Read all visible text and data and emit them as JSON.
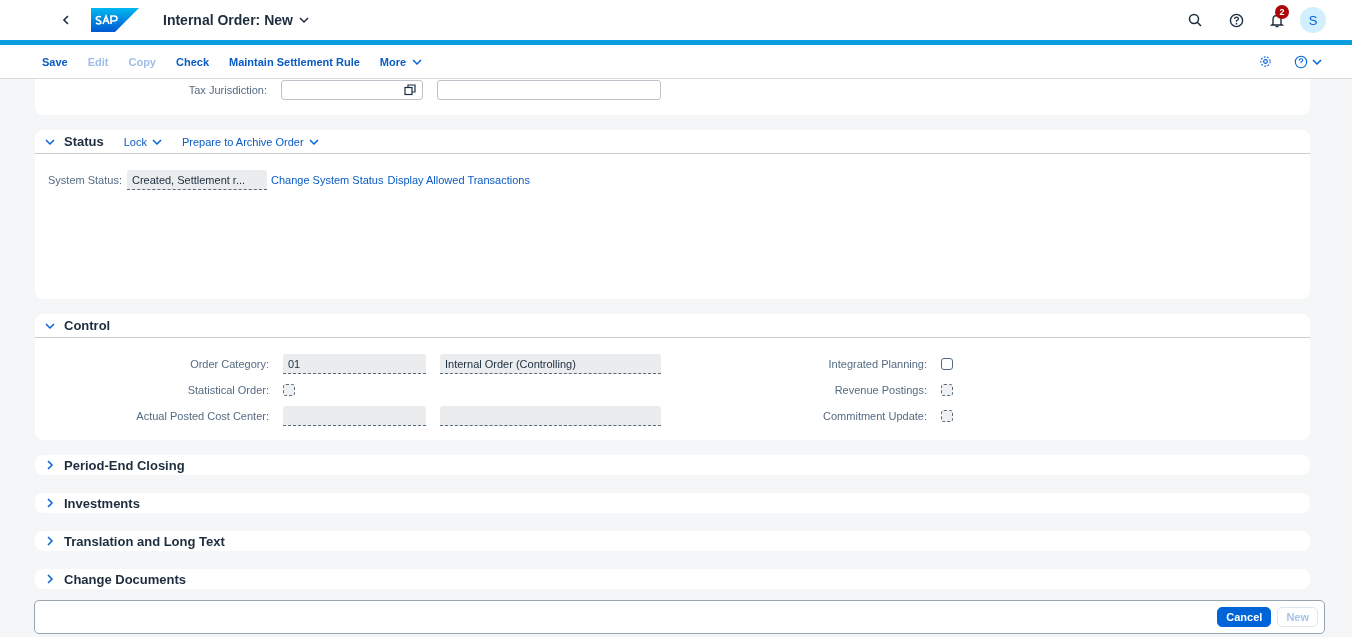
{
  "shell": {
    "title": "Internal Order: New",
    "notification_count": "2",
    "avatar": "S"
  },
  "toolbar": [
    {
      "label": "Save",
      "disabled": false,
      "kind": "button"
    },
    {
      "label": "Edit",
      "disabled": true,
      "kind": "button"
    },
    {
      "label": "Copy",
      "disabled": true,
      "kind": "button"
    },
    {
      "label": "Check",
      "disabled": false,
      "kind": "button"
    },
    {
      "label": "Maintain Settlement Rule",
      "disabled": false,
      "kind": "button"
    },
    {
      "label": "More",
      "disabled": false,
      "kind": "menu"
    }
  ],
  "tax_jurisdiction": {
    "label": "Tax Jurisdiction:"
  },
  "status_section": {
    "title": "Status",
    "expanded": true,
    "menus": [
      "Lock",
      "Prepare to Archive Order"
    ],
    "system_status_label": "System Status:",
    "system_status_value": "Created, Settlement r...",
    "links": [
      "Change System Status",
      "Display Allowed Transactions"
    ]
  },
  "control_section": {
    "title": "Control",
    "expanded": true,
    "left_rows": [
      {
        "label": "Order Category:",
        "kind": "fields",
        "values": [
          "01",
          "Internal Order (Controlling)"
        ]
      },
      {
        "label": "Statistical Order:",
        "kind": "checkbox",
        "checked": false,
        "disabled": true
      },
      {
        "label": "Actual Posted Cost Center:",
        "kind": "blank_fields"
      }
    ],
    "right_rows": [
      {
        "label": "Integrated Planning:",
        "checked": false,
        "disabled": false
      },
      {
        "label": "Revenue Postings:",
        "checked": false,
        "disabled": true
      },
      {
        "label": "Commitment Update:",
        "checked": false,
        "disabled": true
      }
    ]
  },
  "collapsed_sections": [
    {
      "title": "Period-End Closing",
      "expanded": false
    },
    {
      "title": "Investments",
      "expanded": false
    },
    {
      "title": "Translation and Long Text",
      "expanded": false
    },
    {
      "title": "Change Documents",
      "expanded": false
    }
  ],
  "footer": [
    {
      "label": "Cancel",
      "kind": "emphasized",
      "disabled": false
    },
    {
      "label": "New",
      "kind": "ghost",
      "disabled": true
    }
  ]
}
